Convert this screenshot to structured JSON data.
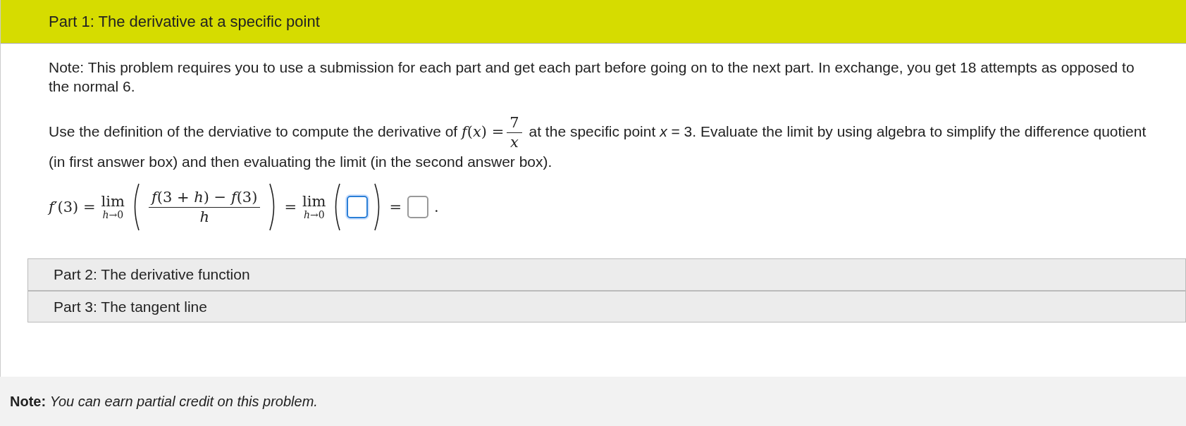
{
  "part1": {
    "title": "Part 1: The derivative at a specific point",
    "expanded": true,
    "note": "Note: This problem requires you to use a submission for each part and get each part before going on to the next part. In exchange, you get 18 attempts as opposed to the normal 6.",
    "question": {
      "before": "Use the definition of the derviative to compute the derivative of ",
      "lhs": "*f*(*x*) =",
      "numerator": "7",
      "denominator": "*x*",
      "after": " at the specific point *x* = 3. Evaluate the limit by using algebra to simplify the difference quotient (in first answer box) and then evaluating the limit (in the second answer box)."
    },
    "formula": {
      "lhs": "*f*′(3) =",
      "lim1": "lim",
      "sub1": "*h*→0",
      "numerator": "*f*(3 + *h*) − *f*(3)",
      "denominator": "*h*",
      "eq1": "=",
      "lim2": "lim",
      "sub2": "*h*→0",
      "eq2": "=",
      "dot": "."
    },
    "answer_boxes": [
      {
        "focused": true
      },
      {
        "focused": false
      }
    ]
  },
  "parts": [
    {
      "title": "Part 2: The derivative function",
      "expanded": false
    },
    {
      "title": "Part 3: The tangent line",
      "expanded": false
    }
  ],
  "footer_note": "**Note:** *You can earn partial credit on this problem.*"
}
